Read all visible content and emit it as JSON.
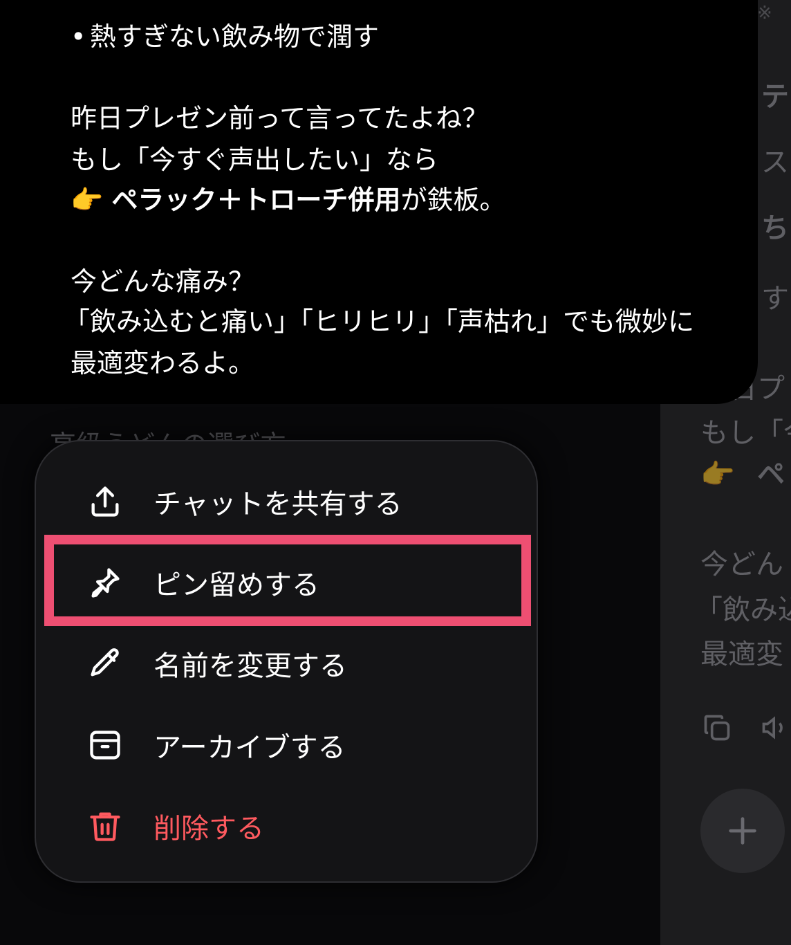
{
  "message": {
    "lines": [
      {
        "text": "熱すぎない飲み物で潤す",
        "bullet": "•"
      },
      {
        "text": "昨日プレゼン前って言ってたよね？"
      },
      {
        "text": "もし「今すぐ声出したい」なら"
      },
      {
        "emoji": "👉",
        "bold": "ペラック＋トローチ併用",
        "rest": "が鉄板。"
      },
      {
        "text": "今どんな痛み？"
      },
      {
        "text": "「飲み込むと痛い」「ヒリヒリ」「声枯れ」でも微妙に"
      },
      {
        "text": "最適変わるよ。"
      }
    ]
  },
  "faded_chat_title": "高級うどんの選び方",
  "menu": {
    "items": [
      {
        "label": "チャットを共有する",
        "icon": "share-icon"
      },
      {
        "label": "ピン留めする",
        "icon": "pin-icon"
      },
      {
        "label": "名前を変更する",
        "icon": "pencil-icon"
      },
      {
        "label": "アーカイブする",
        "icon": "archive-icon"
      },
      {
        "label": "削除する",
        "icon": "trash-icon"
      }
    ],
    "danger_color": "#ff5a5f",
    "highlight_color": "#ee4f72"
  },
  "background_chat": {
    "corner": "※",
    "lines": [
      "テ",
      "ス",
      "ち",
      "す",
      "日プ",
      "もし「今",
      "ペ",
      "今どん",
      "「飲み込",
      "最適変"
    ],
    "emoji": "👉"
  }
}
